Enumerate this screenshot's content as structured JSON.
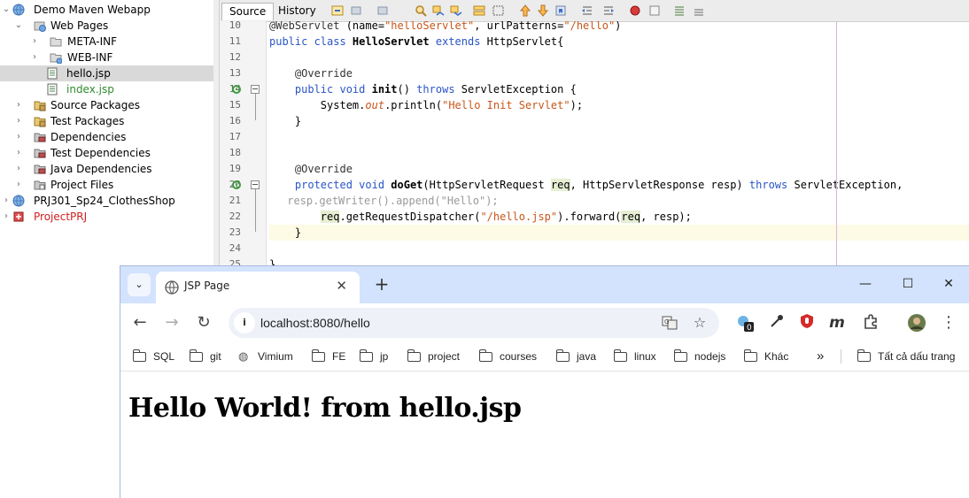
{
  "tree": {
    "items": [
      {
        "label": "Demo Maven Webapp",
        "color": "#000000"
      },
      {
        "label": "Web Pages",
        "color": "#000000"
      },
      {
        "label": "META-INF",
        "color": "#000000"
      },
      {
        "label": "WEB-INF",
        "color": "#000000"
      },
      {
        "label": "hello.jsp",
        "color": "#000000"
      },
      {
        "label": "index.jsp",
        "color": "#2e8b2e"
      },
      {
        "label": "Source Packages",
        "color": "#000000"
      },
      {
        "label": "Test Packages",
        "color": "#000000"
      },
      {
        "label": "Dependencies",
        "color": "#000000"
      },
      {
        "label": "Test Dependencies",
        "color": "#000000"
      },
      {
        "label": "Java Dependencies",
        "color": "#000000"
      },
      {
        "label": "Project Files",
        "color": "#000000"
      },
      {
        "label": "PRJ301_Sp24_ClothesShop",
        "color": "#000000"
      },
      {
        "label": "ProjectPRJ",
        "color": "#d02020"
      }
    ],
    "selected": "hello.jsp"
  },
  "editor": {
    "tabs": {
      "source": "Source",
      "history": "History"
    },
    "line_numbers": [
      "10",
      "11",
      "12",
      "13",
      "14",
      "15",
      "16",
      "17",
      "18",
      "19",
      "20",
      "21",
      "22",
      "23",
      "24",
      "25"
    ],
    "lines": {
      "l10": [
        "@WebServlet",
        " (name=",
        "\"helloServlet\"",
        ", urlPatterns=",
        "\"/hello\"",
        ")"
      ],
      "l11": [
        "public class ",
        "HelloServlet",
        " extends ",
        "HttpServlet{"
      ],
      "l13": [
        "    @Override"
      ],
      "l14": [
        "    ",
        "public void ",
        "init",
        "() ",
        "throws ",
        "ServletException {"
      ],
      "l15": [
        "        System.",
        "out",
        ".println(",
        "\"Hello Init Servlet\"",
        ");"
      ],
      "l16": [
        "    }"
      ],
      "l19": [
        "    @Override"
      ],
      "l20": [
        "    ",
        "protected void ",
        "doGet",
        "(HttpServletRequest ",
        "req",
        ", HttpServletResponse resp) ",
        "throws ",
        "ServletException,"
      ],
      "l21": [
        "//        resp.getWriter().append(\"Hello\");"
      ],
      "l22": [
        "        ",
        "req",
        ".getRequestDispatcher(",
        "\"/hello.jsp\"",
        ").forward(",
        "req",
        ", resp);"
      ],
      "l23": [
        "    }"
      ],
      "l25": [
        "}"
      ]
    }
  },
  "browser": {
    "tab_title": "JSP Page",
    "url": "localhost:8080/hello",
    "extension_badge": "0",
    "bookmarks": [
      "SQL",
      "git",
      "Vimium",
      "FE",
      "jp",
      "project",
      "courses",
      "java",
      "linux",
      "nodejs",
      "Khác"
    ],
    "more_bookmarks": "»",
    "all_bookmarks": "Tất cả dấu trang",
    "page_heading": "Hello World! from hello.jsp"
  }
}
